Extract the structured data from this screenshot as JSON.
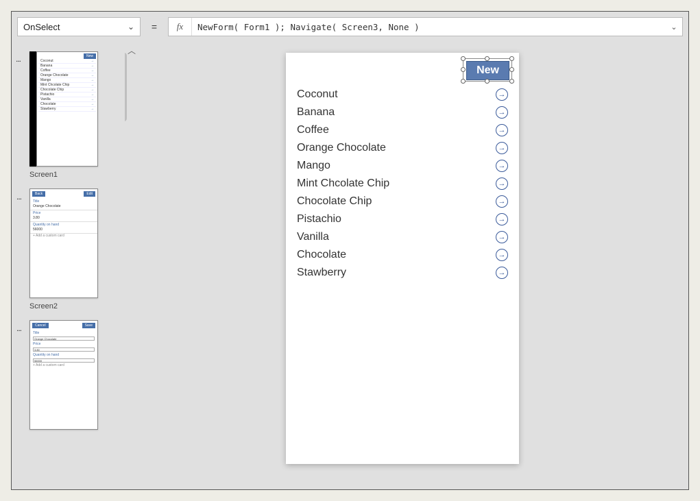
{
  "formula": {
    "property": "OnSelect",
    "fx": "fx",
    "equals": "=",
    "expression": "NewForm( Form1 ); Navigate( Screen3, None )"
  },
  "thumbs": {
    "more": "...",
    "screen1": {
      "caption": "Screen1",
      "newLabel": "New",
      "items": [
        "Coconut",
        "Banana",
        "Coffee",
        "Orange Chocolate",
        "Mango",
        "Mint Chcolate Chip",
        "Chocolate Chip",
        "Pistachio",
        "Vanilla",
        "Chocolate",
        "Stawberry"
      ]
    },
    "screen2": {
      "caption": "Screen2",
      "back": "Back",
      "edit": "Edit",
      "fields": [
        {
          "label": "Title",
          "value": "Orange Chocolate"
        },
        {
          "label": "Price",
          "value": "3.80"
        },
        {
          "label": "Quantity on hand",
          "value": "56000"
        }
      ],
      "addCard": "+  Add a custom card"
    },
    "screen3": {
      "cancel": "Cancel",
      "save": "Save",
      "fields": [
        {
          "label": "Title",
          "value": "Orange Chocolate"
        },
        {
          "label": "Price",
          "value": "3.80"
        },
        {
          "label": "Quantity on hand",
          "value": "56000"
        }
      ],
      "addCard": "+  Add a custom card"
    }
  },
  "canvas": {
    "newLabel": "New",
    "items": [
      "Coconut",
      "Banana",
      "Coffee",
      "Orange Chocolate",
      "Mango",
      "Mint Chcolate Chip",
      "Chocolate Chip",
      "Pistachio",
      "Vanilla",
      "Chocolate",
      "Stawberry"
    ]
  },
  "icons": {
    "arrow": "→",
    "chevDown": "⌄",
    "chevUp": "︿"
  }
}
